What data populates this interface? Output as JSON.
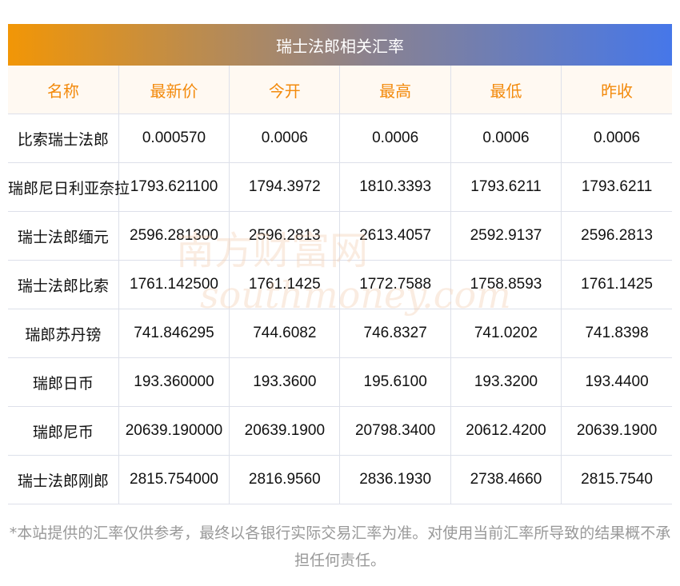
{
  "title": "瑞士法郎相关汇率",
  "columns": [
    "名称",
    "最新价",
    "今开",
    "最高",
    "最低",
    "昨收"
  ],
  "rows": [
    [
      "比索瑞士法郎",
      "0.000570",
      "0.0006",
      "0.0006",
      "0.0006",
      "0.0006"
    ],
    [
      "瑞郎尼日利亚奈拉",
      "1793.621100",
      "1794.3972",
      "1810.3393",
      "1793.6211",
      "1793.6211"
    ],
    [
      "瑞士法郎缅元",
      "2596.281300",
      "2596.2813",
      "2613.4057",
      "2592.9137",
      "2596.2813"
    ],
    [
      "瑞士法郎比索",
      "1761.142500",
      "1761.1425",
      "1772.7588",
      "1758.8593",
      "1761.1425"
    ],
    [
      "瑞郎苏丹镑",
      "741.846295",
      "744.6082",
      "746.8327",
      "741.0202",
      "741.8398"
    ],
    [
      "瑞郎日币",
      "193.360000",
      "193.3600",
      "195.6100",
      "193.3200",
      "193.4400"
    ],
    [
      "瑞郎尼币",
      "20639.190000",
      "20639.1900",
      "20798.3400",
      "20612.4200",
      "20639.1900"
    ],
    [
      "瑞士法郎刚郎",
      "2815.754000",
      "2816.9560",
      "2836.1930",
      "2738.4660",
      "2815.7540"
    ]
  ],
  "watermark": {
    "cn": "南方财富网",
    "en": "southmoney.com"
  },
  "note": "*本站提供的汇率仅供参考，最终以各银行实际交易汇率为准。对使用当前汇率所导致的结果概不承担任何责任。"
}
